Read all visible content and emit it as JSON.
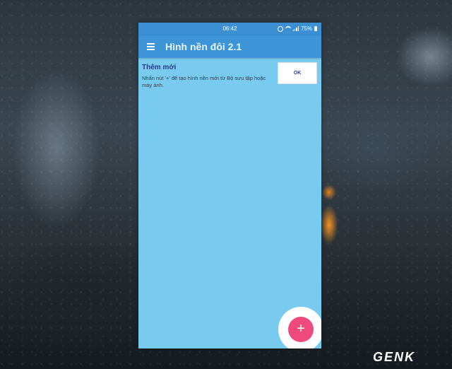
{
  "statusbar": {
    "time": "06:42",
    "battery": "75%"
  },
  "appbar": {
    "title": "Hình nền đôi 2.1"
  },
  "card": {
    "heading": "Thêm mới",
    "description": "Nhấn nút '+' để tạo hình nền mới từ Bộ sưu tập hoặc máy ảnh.",
    "ok_label": "OK"
  },
  "fab": {
    "label": "+"
  },
  "watermark": {
    "text": "GENK"
  },
  "colors": {
    "statusbar": "#3b8fd2",
    "appbar": "#3d94d6",
    "content_bg": "#78cbef",
    "fab": "#ef4a7e",
    "heading": "#283b8c"
  },
  "icons": [
    "menu-icon",
    "alarm-icon",
    "wifi-icon",
    "signal-icon",
    "battery-icon",
    "plus-icon"
  ]
}
